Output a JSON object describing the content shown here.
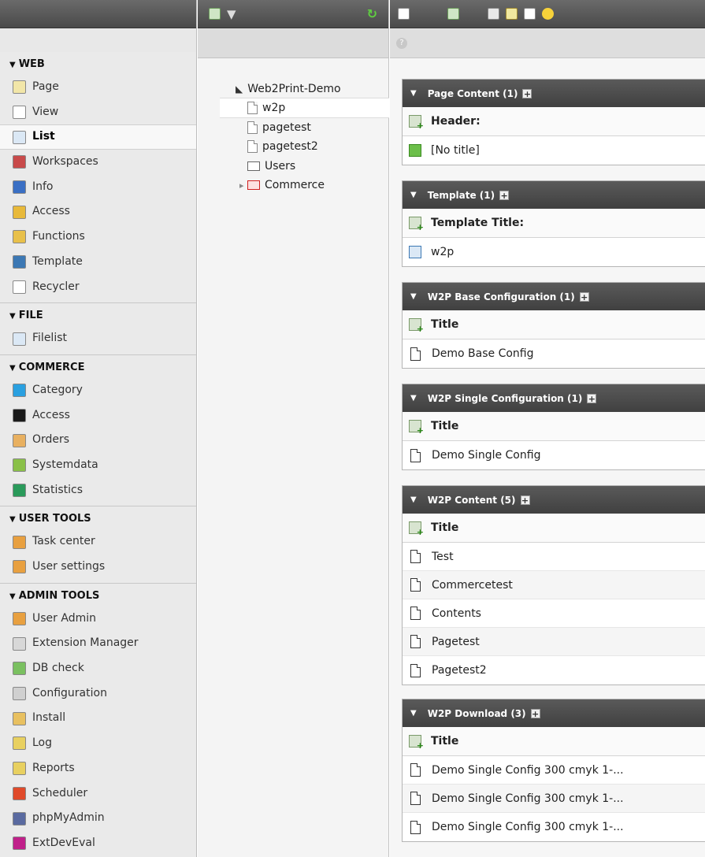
{
  "menu": {
    "groups": [
      {
        "title": "WEB",
        "items": [
          {
            "label": "Page",
            "icon": "pencil-page-icon"
          },
          {
            "label": "View",
            "icon": "eye-icon"
          },
          {
            "label": "List",
            "icon": "list-icon",
            "active": true
          },
          {
            "label": "Workspaces",
            "icon": "workspaces-icon"
          },
          {
            "label": "Info",
            "icon": "info-icon"
          },
          {
            "label": "Access",
            "icon": "lock-icon"
          },
          {
            "label": "Functions",
            "icon": "wand-icon"
          },
          {
            "label": "Template",
            "icon": "template-icon"
          },
          {
            "label": "Recycler",
            "icon": "trash-icon"
          }
        ]
      },
      {
        "title": "FILE",
        "items": [
          {
            "label": "Filelist",
            "icon": "folder-list-icon"
          }
        ]
      },
      {
        "title": "COMMERCE",
        "items": [
          {
            "label": "Category",
            "icon": "category-icon"
          },
          {
            "label": "Access",
            "icon": "commerce-access-icon"
          },
          {
            "label": "Orders",
            "icon": "orders-icon"
          },
          {
            "label": "Systemdata",
            "icon": "systemdata-icon"
          },
          {
            "label": "Statistics",
            "icon": "statistics-icon"
          }
        ]
      },
      {
        "title": "USER TOOLS",
        "items": [
          {
            "label": "Task center",
            "icon": "task-center-icon"
          },
          {
            "label": "User settings",
            "icon": "user-settings-icon"
          }
        ]
      },
      {
        "title": "ADMIN TOOLS",
        "items": [
          {
            "label": "User Admin",
            "icon": "user-admin-icon"
          },
          {
            "label": "Extension Manager",
            "icon": "extension-manager-icon"
          },
          {
            "label": "DB check",
            "icon": "db-check-icon"
          },
          {
            "label": "Configuration",
            "icon": "configuration-icon"
          },
          {
            "label": "Install",
            "icon": "install-icon"
          },
          {
            "label": "Log",
            "icon": "log-icon"
          },
          {
            "label": "Reports",
            "icon": "reports-icon"
          },
          {
            "label": "Scheduler",
            "icon": "scheduler-icon"
          },
          {
            "label": "phpMyAdmin",
            "icon": "phpmyadmin-icon"
          },
          {
            "label": "ExtDevEval",
            "icon": "extdeveval-icon"
          }
        ]
      }
    ]
  },
  "tree": {
    "root": "Web2Print-Demo",
    "nodes": [
      {
        "label": "w2p",
        "type": "page",
        "selected": true
      },
      {
        "label": "pagetest",
        "type": "page"
      },
      {
        "label": "pagetest2",
        "type": "page"
      },
      {
        "label": "Users",
        "type": "folder"
      },
      {
        "label": "Commerce",
        "type": "commerce"
      }
    ]
  },
  "content": {
    "help": "?",
    "tables": [
      {
        "title": "Page Content (1)",
        "column": "Header:",
        "rows": [
          "[No title]"
        ],
        "rowicon": "green"
      },
      {
        "title": "Template (1)",
        "column": "Template Title:",
        "rows": [
          "w2p"
        ],
        "rowicon": "template"
      },
      {
        "title": "W2P Base Configuration (1)",
        "column": "Title",
        "rows": [
          "Demo Base Config"
        ],
        "rowicon": "doc"
      },
      {
        "title": "W2P Single Configuration (1)",
        "column": "Title",
        "rows": [
          "Demo Single Config"
        ],
        "rowicon": "doc"
      },
      {
        "title": "W2P Content (5)",
        "column": "Title",
        "rows": [
          "Test",
          "Commercetest",
          "Contents",
          "Pagetest",
          "Pagetest2"
        ],
        "rowicon": "doc"
      },
      {
        "title": "W2P Download (3)",
        "column": "Title",
        "rows": [
          "Demo Single Config 300 cmyk 1-...",
          "Demo Single Config 300 cmyk 1-...",
          "Demo Single Config 300 cmyk 1-..."
        ],
        "rowicon": "doc"
      }
    ]
  },
  "colors": {
    "bar_dark": "#4a4a4a",
    "menu_bg": "#eaeaea",
    "accent_green": "#3ca020",
    "folder_red": "#d02020"
  }
}
